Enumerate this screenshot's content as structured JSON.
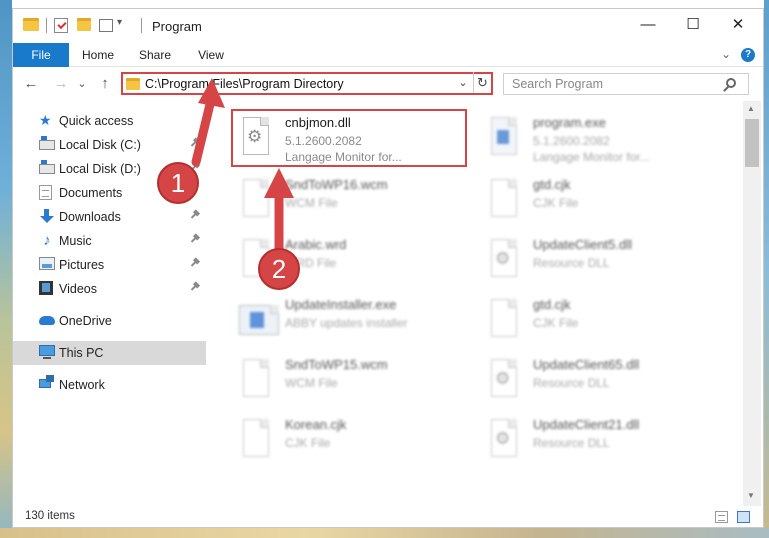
{
  "window": {
    "title": "Program",
    "minimize": "—",
    "maximize": "☐",
    "close": "✕"
  },
  "ribbon": {
    "tabs": [
      "File",
      "Home",
      "Share",
      "View"
    ],
    "help": "?",
    "collapse": "⌄"
  },
  "nav": {
    "back": "←",
    "forward": "→",
    "recent": "⌄",
    "up": "↑",
    "address": "C:\\Program Files\\Program Directory",
    "address_dropdown": "⌄",
    "refresh": "↻",
    "search_placeholder": "Search Program"
  },
  "sidebar": {
    "items": [
      {
        "label": "Quick access",
        "icon": "star-icon"
      },
      {
        "label": "Local Disk (C:)",
        "icon": "disk-icon"
      },
      {
        "label": "Local Disk (D:)",
        "icon": "disk-icon"
      },
      {
        "label": "Documents",
        "icon": "documents-icon"
      },
      {
        "label": "Downloads",
        "icon": "download-icon"
      },
      {
        "label": "Music",
        "icon": "music-icon"
      },
      {
        "label": "Pictures",
        "icon": "pictures-icon"
      },
      {
        "label": "Videos",
        "icon": "video-icon"
      },
      {
        "label": "OneDrive",
        "icon": "cloud-icon"
      },
      {
        "label": "This PC",
        "icon": "computer-icon"
      },
      {
        "label": "Network",
        "icon": "network-icon"
      }
    ]
  },
  "files": [
    {
      "name": "cnbjmon.dll",
      "line1": "5.1.2600.2082",
      "line2": "Langage Monitor for...",
      "icon": "dll-file-icon"
    },
    {
      "name": "program.exe",
      "line1": "5.1.2600.2082",
      "line2": "Langage Monitor for...",
      "icon": "exe-file-icon"
    },
    {
      "name": "SndToWP16.wcm",
      "line1": "WCM File",
      "icon": "generic-file-icon"
    },
    {
      "name": "gtd.cjk",
      "line1": "CJK File",
      "icon": "generic-file-icon"
    },
    {
      "name": "Arabic.wrd",
      "line1": "WRD File",
      "icon": "generic-file-icon"
    },
    {
      "name": "UpdateClient5.dll",
      "line1": "Resource DLL",
      "icon": "dll-file-icon"
    },
    {
      "name": "UpdateInstaller.exe",
      "line1": "ABBY updates installer",
      "icon": "installer-file-icon"
    },
    {
      "name": "gtd.cjk",
      "line1": "CJK File",
      "icon": "generic-file-icon"
    },
    {
      "name": "SndToWP15.wcm",
      "line1": "WCM File",
      "icon": "generic-file-icon"
    },
    {
      "name": "UpdateClient65.dll",
      "line1": "Resource DLL",
      "icon": "dll-file-icon"
    },
    {
      "name": "Korean.cjk",
      "line1": "CJK File",
      "icon": "generic-file-icon"
    },
    {
      "name": "UpdateClient21.dll",
      "line1": "Resource DLL",
      "icon": "dll-file-icon"
    }
  ],
  "status": {
    "item_count": "130 items"
  },
  "annotations": {
    "marker1": "1",
    "marker2": "2",
    "color": "#d64545"
  },
  "colors": {
    "accent": "#1979ca",
    "selected": "#d9d9d9"
  }
}
